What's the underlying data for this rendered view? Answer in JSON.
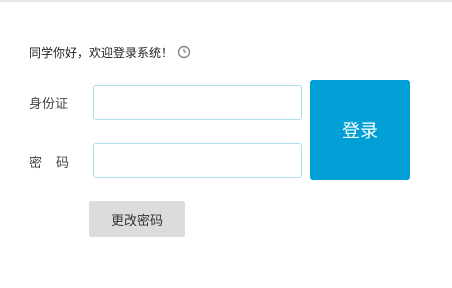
{
  "greeting": {
    "text": "同学你好，欢迎登录系统！",
    "icon": "clock-icon"
  },
  "form": {
    "id_label": "身份证",
    "id_value": "",
    "password_label": "密码",
    "password_value": ""
  },
  "buttons": {
    "login_label": "登录",
    "change_password_label": "更改密码"
  },
  "colors": {
    "login_button": "#00a0d6",
    "input_border": "#a9e0ea",
    "change_password_button": "#dcdcdc"
  }
}
